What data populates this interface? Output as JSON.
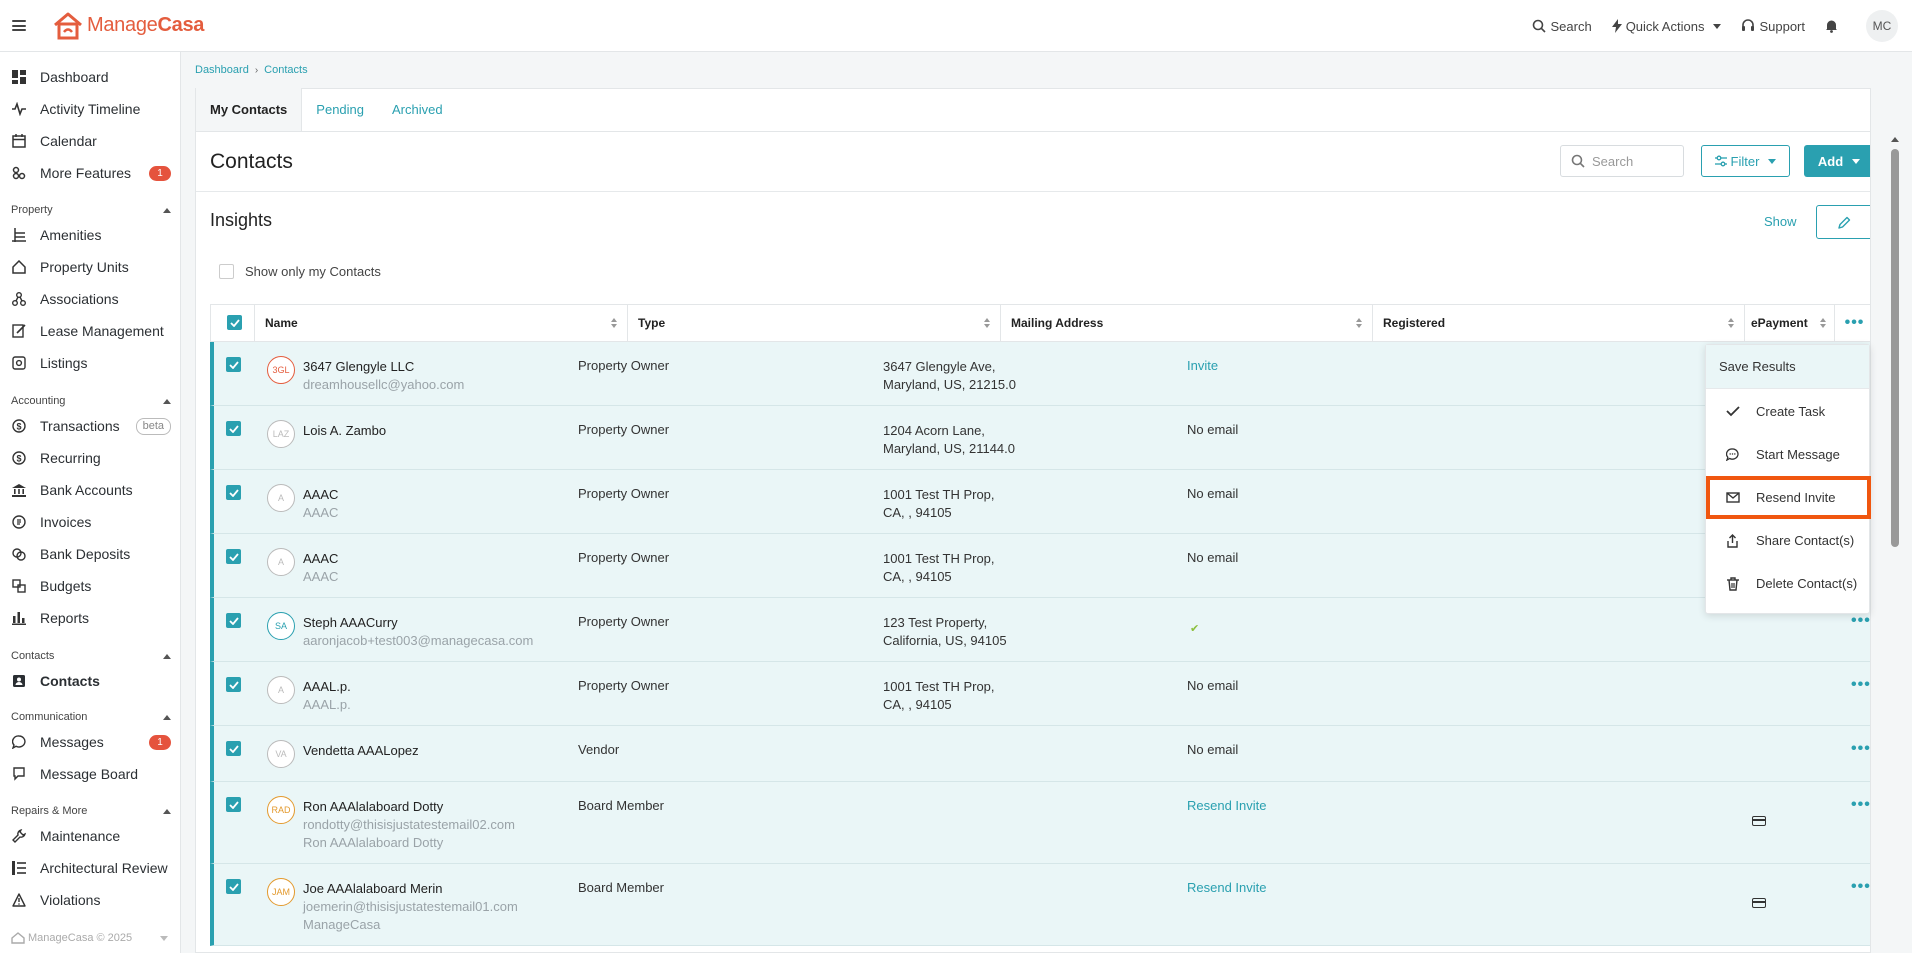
{
  "app": {
    "logo_text_1": "Manage",
    "logo_text_2": "Casa",
    "brand_color": "#e45d3e",
    "accent_color": "#2aa0b0"
  },
  "topbar": {
    "search_label": "Search",
    "quick_actions_label": "Quick Actions",
    "support_label": "Support",
    "avatar_initials": "MC"
  },
  "sidebar": {
    "items": [
      {
        "label": "Dashboard",
        "icon": "dashboard-icon"
      },
      {
        "label": "Activity Timeline",
        "icon": "activity-icon"
      },
      {
        "label": "Calendar",
        "icon": "calendar-icon"
      },
      {
        "label": "More Features",
        "icon": "features-icon",
        "badge": "1"
      }
    ],
    "sections": [
      {
        "title": "Property",
        "items": [
          {
            "label": "Amenities"
          },
          {
            "label": "Property Units"
          },
          {
            "label": "Associations"
          },
          {
            "label": "Lease Management"
          },
          {
            "label": "Listings"
          }
        ]
      },
      {
        "title": "Accounting",
        "items": [
          {
            "label": "Transactions",
            "tag": "beta"
          },
          {
            "label": "Recurring"
          },
          {
            "label": "Bank Accounts"
          },
          {
            "label": "Invoices"
          },
          {
            "label": "Bank Deposits"
          },
          {
            "label": "Budgets"
          },
          {
            "label": "Reports"
          }
        ]
      },
      {
        "title": "Contacts",
        "items": [
          {
            "label": "Contacts"
          }
        ]
      },
      {
        "title": "Communication",
        "items": [
          {
            "label": "Messages",
            "badge": "1"
          },
          {
            "label": "Message Board"
          }
        ]
      },
      {
        "title": "Repairs & More",
        "items": [
          {
            "label": "Maintenance"
          },
          {
            "label": "Architectural Review"
          },
          {
            "label": "Violations"
          }
        ]
      }
    ],
    "footer_logo": "ManageCasa",
    "footer_copyright": "© 2025"
  },
  "breadcrumb": {
    "items": [
      "Dashboard",
      "Contacts"
    ]
  },
  "tabs": [
    "My Contacts",
    "Pending",
    "Archived"
  ],
  "page": {
    "title": "Contacts",
    "search_placeholder": "Search",
    "filter_label": "Filter",
    "add_label": "Add",
    "insights_title": "Insights",
    "show_label": "Show",
    "show_only_mine_label": "Show only my Contacts"
  },
  "table": {
    "columns": [
      "Name",
      "Type",
      "Mailing Address",
      "Registered",
      "ePayment"
    ],
    "rows": [
      {
        "initials": "3GL",
        "name": "3647 Glengyle LLC",
        "sub1": "dreamhousellc@yahoo.com",
        "sub2": "",
        "type": "Property Owner",
        "addr1": "3647 Glengyle Ave,",
        "addr2": "Maryland, US, 21215.0",
        "registered": "Invite",
        "reg_link": true
      },
      {
        "initials": "LAZ",
        "name": "Lois A. Zambo",
        "sub1": "",
        "sub2": "",
        "type": "Property Owner",
        "addr1": "1204 Acorn Lane,",
        "addr2": "Maryland, US, 21144.0",
        "registered": "No email",
        "reg_link": false
      },
      {
        "initials": "A",
        "name": "AAAC",
        "sub1": "AAAC",
        "sub2": "",
        "type": "Property Owner",
        "addr1": "1001 Test TH Prop,",
        "addr2": "CA, , 94105",
        "registered": "No email",
        "reg_link": false
      },
      {
        "initials": "A",
        "name": "AAAC",
        "sub1": "AAAC",
        "sub2": "",
        "type": "Property Owner",
        "addr1": "1001 Test TH Prop,",
        "addr2": "CA, , 94105",
        "registered": "No email",
        "reg_link": false
      },
      {
        "initials": "SA",
        "name": "Steph AAACurry",
        "sub1": "aaronjacob+test003@managecasa.com",
        "sub2": "",
        "type": "Property Owner",
        "addr1": "123 Test Property,",
        "addr2": "California, US, 94105",
        "registered": "✔",
        "reg_link": false
      },
      {
        "initials": "A",
        "name": "AAAL.p.",
        "sub1": "AAAL.p.",
        "sub2": "",
        "type": "Property Owner",
        "addr1": "1001 Test TH Prop,",
        "addr2": "CA, , 94105",
        "registered": "No email",
        "reg_link": false
      },
      {
        "initials": "VA",
        "name": "Vendetta AAALopez",
        "sub1": "",
        "sub2": "",
        "type": "Vendor",
        "addr1": "",
        "addr2": "",
        "registered": "No email",
        "reg_link": false
      },
      {
        "initials": "RAD",
        "name": "Ron AAAlalaboard Dotty",
        "sub1": "rondotty@thisisjustatestemail02.com",
        "sub2": "Ron AAAlalaboard Dotty",
        "type": "Board Member",
        "addr1": "",
        "addr2": "",
        "registered": "Resend Invite",
        "reg_link": true
      },
      {
        "initials": "JAM",
        "name": "Joe AAAlalaboard Merin",
        "sub1": "joemerin@thisisjustatestemail01.com",
        "sub2": "ManageCasa",
        "type": "Board Member",
        "addr1": "",
        "addr2": "",
        "registered": "Resend Invite",
        "reg_link": true
      }
    ]
  },
  "menu": {
    "header": "Save Results",
    "items": [
      "Create Task",
      "Start Message",
      "Resend Invite",
      "Share Contact(s)",
      "Delete Contact(s)"
    ]
  }
}
